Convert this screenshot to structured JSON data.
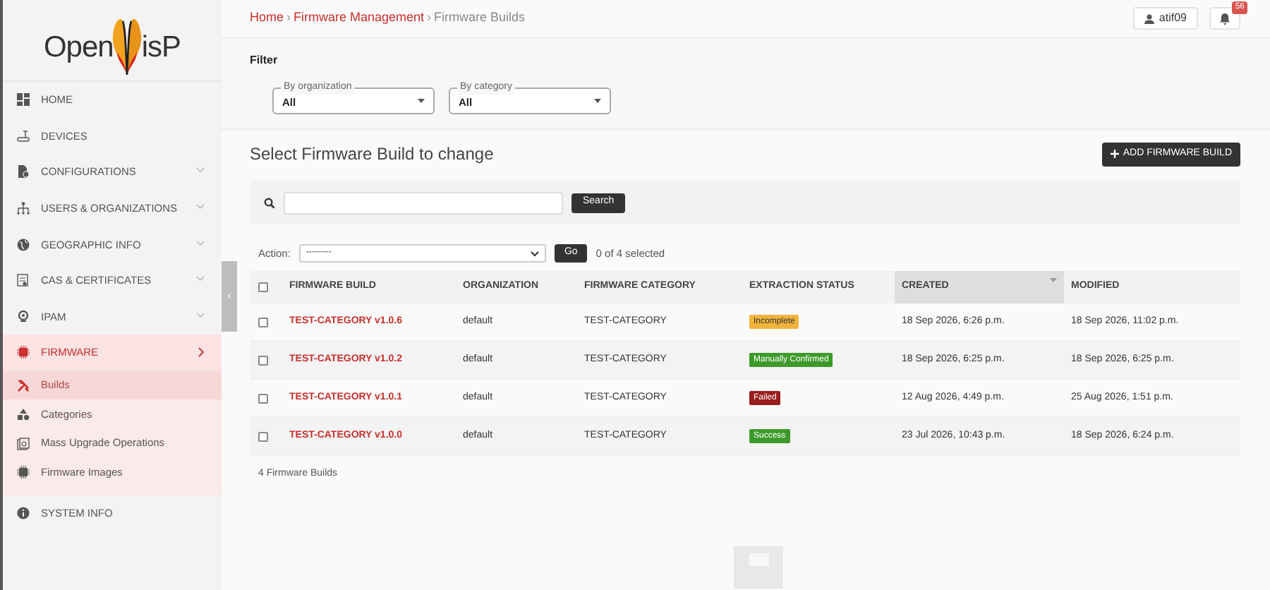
{
  "logo": {
    "text_before": "Open",
    "text_after": "isP"
  },
  "sidebar": {
    "items": [
      {
        "label": "HOME",
        "selected": false,
        "expandable": false
      },
      {
        "label": "DEVICES",
        "selected": false,
        "expandable": false
      },
      {
        "label": "CONFIGURATIONS",
        "selected": false,
        "expandable": true,
        "expanded": false
      },
      {
        "label": "USERS & ORGANIZATIONS",
        "selected": false,
        "expandable": true,
        "expanded": false
      },
      {
        "label": "GEOGRAPHIC INFO",
        "selected": false,
        "expandable": true,
        "expanded": false
      },
      {
        "label": "CAS & CERTIFICATES",
        "selected": false,
        "expandable": true,
        "expanded": false
      },
      {
        "label": "IPAM",
        "selected": false,
        "expandable": true,
        "expanded": false
      },
      {
        "label": "FIRMWARE",
        "selected": true,
        "expandable": true,
        "expanded": true,
        "children": [
          {
            "label": "Builds",
            "selected": true
          },
          {
            "label": "Categories",
            "selected": false
          },
          {
            "label": "Mass Upgrade Operations",
            "selected": false
          },
          {
            "label": "Firmware Images",
            "selected": false
          }
        ]
      },
      {
        "label": "SYSTEM INFO",
        "selected": false,
        "expandable": false
      }
    ],
    "toggle": "‹"
  },
  "breadcrumb": [
    {
      "label": "Home",
      "link": true
    },
    {
      "label": "Firmware Management",
      "link": true
    },
    {
      "label": "Firmware Builds",
      "link": false
    }
  ],
  "breadcrumb_separator": "›",
  "user": {
    "name": "atif09"
  },
  "notifications": {
    "count": "56"
  },
  "filter": {
    "title": "Filter",
    "fields": [
      {
        "label": "By organization",
        "value": "All"
      },
      {
        "label": "By category",
        "value": "All"
      }
    ]
  },
  "heading": "Select Firmware Build to change",
  "add_button": "ADD FIRMWARE BUILD",
  "search": {
    "button": "Search"
  },
  "action": {
    "label": "Action:",
    "value": "---------",
    "button": "Go",
    "selected_count": "0 of 4 selected"
  },
  "table": {
    "select_all": {
      "checked": false
    },
    "columns": [
      {
        "label": "FIRMWARE BUILD",
        "sorted": false
      },
      {
        "label": "ORGANIZATION",
        "sorted": false
      },
      {
        "label": "FIRMWARE CATEGORY",
        "sorted": false
      },
      {
        "label": "EXTRACTION STATUS",
        "sorted": false
      },
      {
        "label": "CREATED",
        "sorted": true
      },
      {
        "label": "MODIFIED",
        "sorted": false
      }
    ],
    "rows": [
      {
        "checked": false,
        "build": "TEST-CATEGORY v1.0.6",
        "organization": "default",
        "category": "TEST-CATEGORY",
        "status": {
          "text": "Incomplete",
          "color": "#f0b43c"
        },
        "created": "18 Sep 2026, 6:26 p.m.",
        "modified": "18 Sep 2026, 11:02 p.m."
      },
      {
        "checked": false,
        "build": "TEST-CATEGORY v1.0.2",
        "organization": "default",
        "category": "TEST-CATEGORY",
        "status": {
          "text": "Manually Confirmed",
          "color": "#3d9a2a"
        },
        "created": "18 Sep 2026, 6:25 p.m.",
        "modified": "18 Sep 2026, 6:25 p.m."
      },
      {
        "checked": false,
        "build": "TEST-CATEGORY v1.0.1",
        "organization": "default",
        "category": "TEST-CATEGORY",
        "status": {
          "text": "Failed",
          "color": "#9b1c1c"
        },
        "created": "12 Aug 2026, 4:49 p.m.",
        "modified": "25 Aug 2026, 1:51 p.m."
      },
      {
        "checked": false,
        "build": "TEST-CATEGORY v1.0.0",
        "organization": "default",
        "category": "TEST-CATEGORY",
        "status": {
          "text": "Success",
          "color": "#3d9a2a"
        },
        "created": "23 Jul 2026, 10:43 p.m.",
        "modified": "18 Sep 2026, 6:24 p.m."
      }
    ]
  },
  "result_count": "4 Firmware Builds"
}
